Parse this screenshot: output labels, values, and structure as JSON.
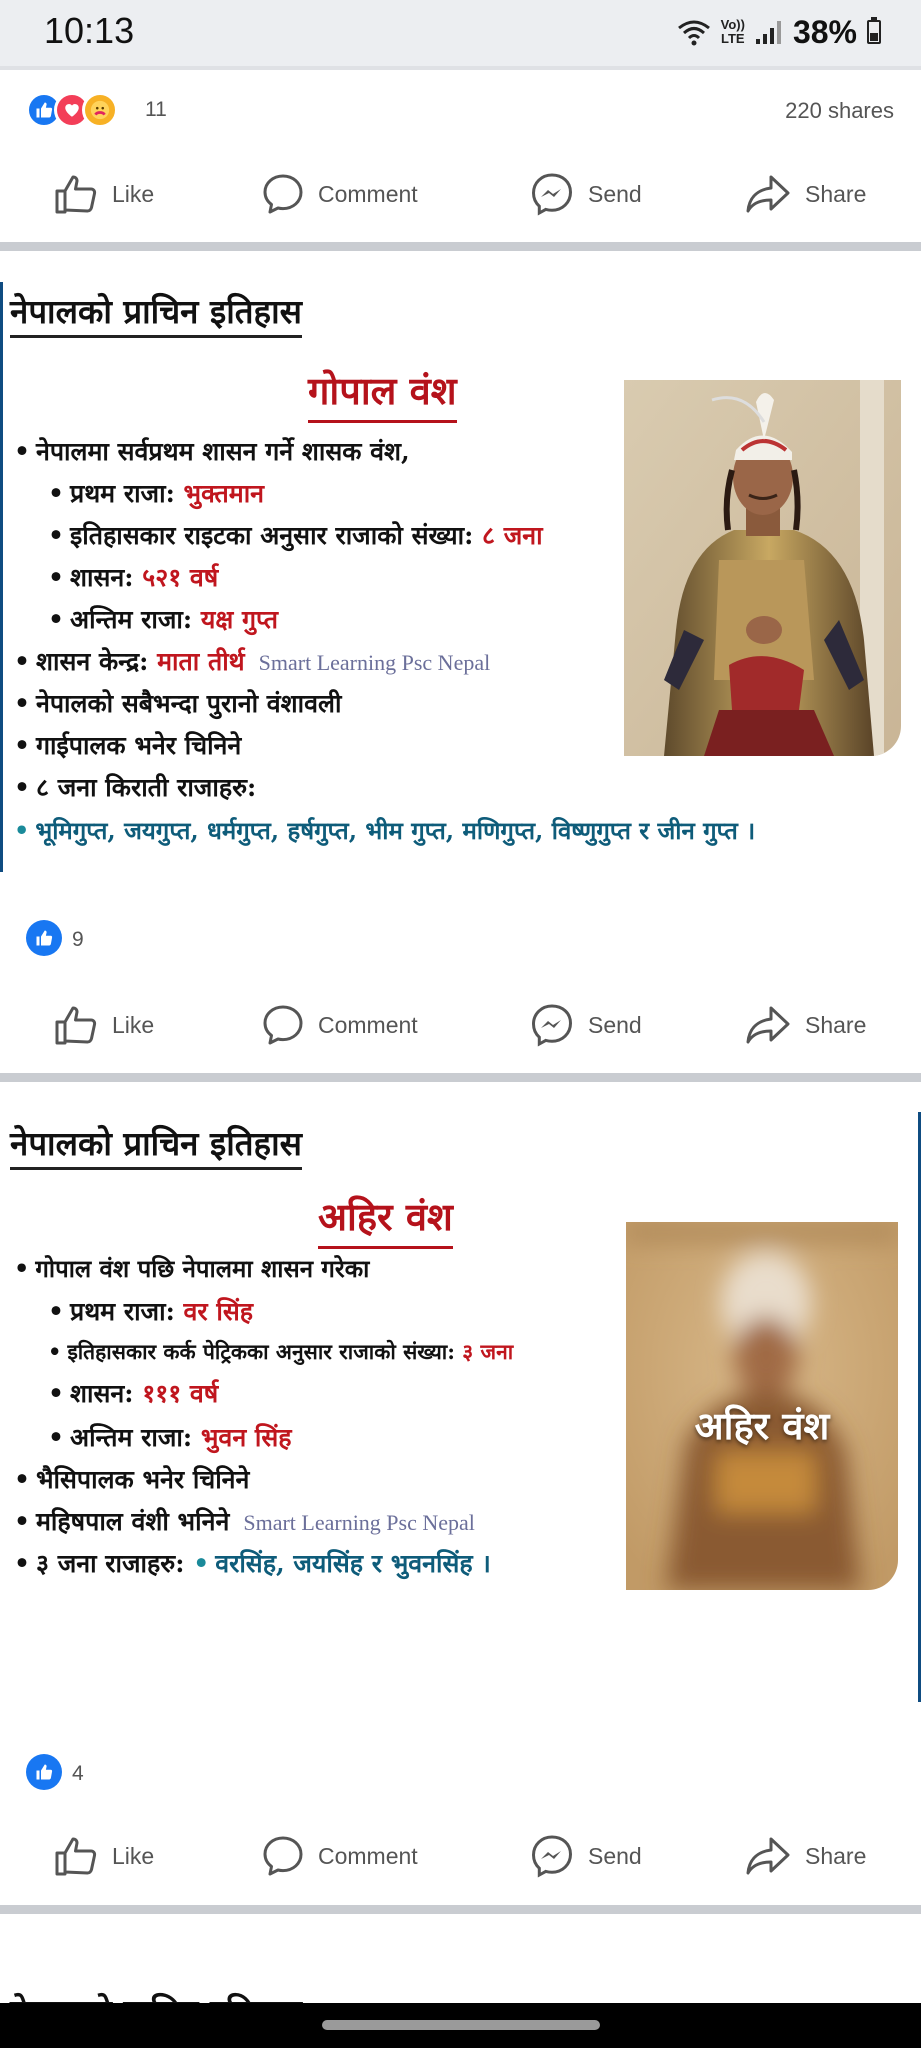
{
  "status": {
    "time": "10:13",
    "volte_top": "Vo))",
    "volte_bottom": "LTE",
    "battery": "38%"
  },
  "post_top": {
    "reaction_count": "11",
    "shares": "220 shares"
  },
  "actions": {
    "like": "Like",
    "comment": "Comment",
    "send": "Send",
    "share": "Share"
  },
  "post1": {
    "title": "नेपालको प्राचिन इतिहास",
    "dynasty": "गोपाल वंश",
    "line1": "नेपालमा सर्वप्रथम शासन गर्ने शासक वंश,",
    "first_king_label": "प्रथम राजा:",
    "first_king": "भुक्तमान",
    "kings_count_label": "इतिहासकार राइटका अनुसार राजाको संख्या:",
    "kings_count": "८ जना",
    "rule_label": "शासन:",
    "rule": "५२१ वर्ष",
    "last_king_label": "अन्तिम राजा:",
    "last_king": "यक्ष गुप्त",
    "capital_label": "शासन केन्द्र:",
    "capital": "माता तीर्थ",
    "watermark": "Smart Learning Psc Nepal",
    "line_oldest": "नेपालको सबैभन्दा पुरानो वंशावली",
    "line_known": "गाईपालक भनेर चिनिने",
    "line_kirati": "८ जना किराती राजाहरु:",
    "kings_list": "भूमिगुप्त, जयगुप्त, धर्मगुप्त, हर्षगुप्त, भीम गुप्त, मणिगुप्त, विष्णुगुप्त र जीन गुप्त ।",
    "like_count": "9"
  },
  "post2": {
    "title": "नेपालको प्राचिन इतिहास",
    "dynasty": "अहिर वंश",
    "line1": "गोपाल वंश पछि नेपालमा शासन गरेका",
    "first_king_label": "प्रथम राजा:",
    "first_king": "वर सिंह",
    "kings_count_label": "इतिहासकार कर्क पेट्रिकका अनुसार राजाको संख्या:",
    "kings_count": "३ जना",
    "rule_label": "शासन:",
    "rule": "१११ वर्ष",
    "last_king_label": "अन्तिम राजा:",
    "last_king": "भुवन सिंह",
    "line_known": "भैसिपालक भनेर चिनिने",
    "line_mahish": "महिषपाल वंशी भनिने",
    "watermark": "Smart Learning Psc Nepal",
    "kings_label": "३ जना राजाहरु:",
    "kings_list": "वरसिंह, जयसिंह र भुवनसिंह ।",
    "image_label": "अहिर वंश",
    "like_count": "4"
  },
  "post3": {
    "title_peek": "नेपालको प्राचिन इतिहास"
  },
  "colors": {
    "facebook_blue": "#1877f2",
    "love_red": "#f33e58",
    "dynasty_red": "#b5121b",
    "divider": "#c9ccd1"
  }
}
